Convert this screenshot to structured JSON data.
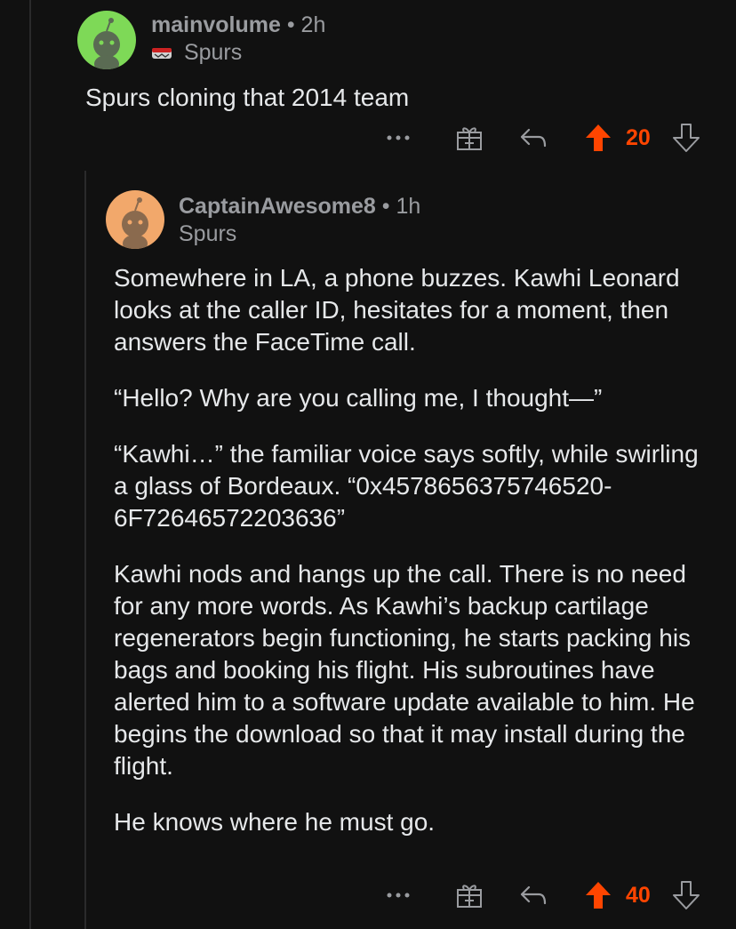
{
  "comments": [
    {
      "username": "mainvolume",
      "separator": "•",
      "time": "2h",
      "flair": "Spurs",
      "avatar_color": "#7ed957",
      "body": [
        "Spurs cloning that 2014 team"
      ],
      "vote_count": "20",
      "upvoted": true,
      "actions": [
        "more-icon",
        "award-icon",
        "reply-icon",
        "upvote-icon",
        "downvote-icon"
      ]
    },
    {
      "username": "CaptainAwesome8",
      "separator": "•",
      "time": "1h",
      "flair": "Spurs",
      "avatar_color": "#f2a86b",
      "body": [
        "Somewhere in LA, a phone buzzes. Kawhi Leonard looks at the caller ID, hesitates for a moment, then answers the FaceTime call.",
        "“Hello? Why are you calling me, I thought—”",
        "“Kawhi…” the familiar voice says softly, while swirling a glass of Bordeaux. “0x4578656375746520­6F72646572203636”",
        "Kawhi nods and hangs up the call. There is no need for any more words. As Kawhi’s backup cartilage regenerators begin functioning, he starts packing his bags and booking his flight. His subroutines have alerted him to a software update available to him. He begins the download so that it may install during the flight.",
        "He knows where he must go."
      ],
      "vote_count": "40",
      "upvoted": true,
      "actions": [
        "more-icon",
        "award-icon",
        "reply-icon",
        "upvote-icon",
        "downvote-icon"
      ]
    }
  ],
  "colors": {
    "background": "#111111",
    "upvote": "#ff4500",
    "muted": "#9a9ca0",
    "text": "#e6e8ea"
  }
}
